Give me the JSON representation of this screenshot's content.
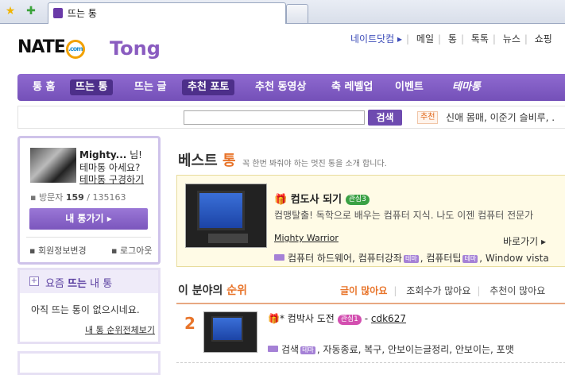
{
  "browser": {
    "tab_title": "뜨는 통"
  },
  "header": {
    "logo_text": "NATE",
    "logo_com": ".com",
    "tong_logo": "Tong",
    "topnav": [
      "네이트닷컴 ▸",
      "메일",
      "통",
      "톡톡",
      "뉴스",
      "쇼핑"
    ]
  },
  "mainnav": {
    "items": [
      "통 홈",
      "뜨는 통",
      "뜨는 글",
      "추천 포토",
      "추천 동영상",
      "축 레벨업",
      "이벤트",
      "테마통"
    ]
  },
  "search": {
    "button": "검색",
    "rec_label": "추천",
    "rec_text": "신애 몸매, 이준기 슬비루, ."
  },
  "profile": {
    "username": "Mighty...",
    "suffix": " 님!",
    "hint1": "테마통 아세요?",
    "hint2": "테마통 구경하기",
    "visitors_label": "방문자",
    "visitors_today": "159",
    "visitors_total": "/ 135163",
    "mytong_button": "내 통가기 ▸",
    "profile_link": "회원정보변경",
    "logout_link": "로그아웃"
  },
  "hot": {
    "title_pre": "요즘",
    "title_bold": "뜨는",
    "title_post": "내 통",
    "empty": "아직 뜨는 통이 없으시네요.",
    "link": "내 통 순위전체보기"
  },
  "best": {
    "title": "베스트",
    "title_accent": "통",
    "subtitle": "꼭 한번 봐줘야 하는 멋진 통을 소개 합니다.",
    "name": "컴도사 되기",
    "badge": "관심3",
    "desc": "컴맹탈출! 독학으로 배우는 컴퓨터 지식. 나도 이젠 컴퓨터 전문가",
    "owner": "Mighty Warrior",
    "go_link": "바로가기 ▸",
    "tags": [
      "컴퓨터 하드웨어,",
      "컴퓨터강좌",
      ", 컴퓨터팁",
      ", Window vista"
    ]
  },
  "ranking": {
    "title_pre": "이 분야의 ",
    "title_accent": "순위",
    "tabs": [
      "글이 많아요",
      "조회수가 많아요",
      "추천이 많아요"
    ],
    "rows": [
      {
        "rank": "2",
        "name": "컴박사 도전",
        "badge": "관심1",
        "owner": "cdk627",
        "tags": "검색",
        "tags_rest": ", 자동종료, 복구, 안보이는글정리, 안보이는, 포맷"
      }
    ]
  },
  "colors": {
    "brand_purple": "#7450b8",
    "accent_orange": "#e8742a"
  }
}
